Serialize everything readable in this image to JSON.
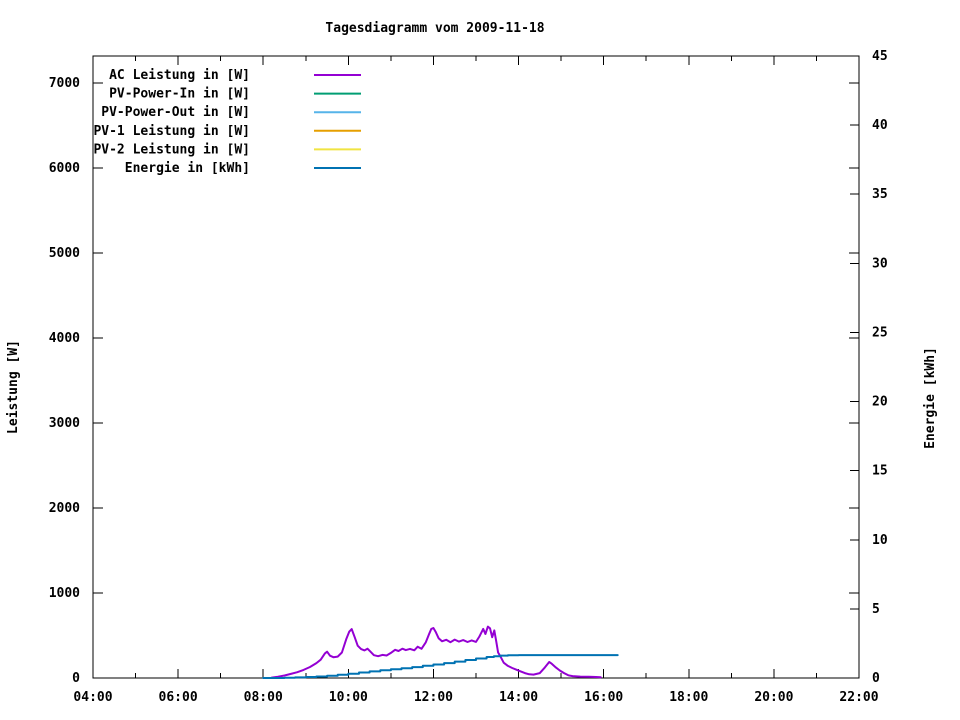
{
  "title": "Tagesdiagramm vom 2009-11-18",
  "chart_data": {
    "type": "line",
    "title": "Tagesdiagramm vom 2009-11-18",
    "x": {
      "range_hours": [
        4,
        22
      ],
      "major_tick_every_h": 2,
      "minor_tick_every_h": 1,
      "tick_labels": [
        "04:00",
        "06:00",
        "08:00",
        "10:00",
        "12:00",
        "14:00",
        "16:00",
        "18:00",
        "20:00",
        "22:00"
      ]
    },
    "y_left": {
      "label": "Leistung [W]",
      "range": [
        0,
        7318
      ],
      "tick_step": 1000,
      "tick_labels": [
        "0",
        "1000",
        "2000",
        "3000",
        "4000",
        "5000",
        "6000",
        "7000"
      ]
    },
    "y_right": {
      "label": "Energie [kWh]",
      "range": [
        0,
        45
      ],
      "tick_step": 5,
      "tick_labels": [
        "0",
        "5",
        "10",
        "15",
        "20",
        "25",
        "30",
        "35",
        "40",
        "45"
      ]
    },
    "legend": {
      "position": "top-left-inside",
      "entries": [
        {
          "label": "AC Leistung in [W]",
          "color": "#9400d3"
        },
        {
          "label": "PV-Power-In in [W]",
          "color": "#009e73"
        },
        {
          "label": "PV-Power-Out in [W]",
          "color": "#56b4e9"
        },
        {
          "label": "PV-1 Leistung in [W]",
          "color": "#e69f00"
        },
        {
          "label": "PV-2 Leistung in [W]",
          "color": "#f0e442"
        },
        {
          "label": "Energie in [kWh]",
          "color": "#0072b2"
        }
      ]
    },
    "series": [
      {
        "name": "AC Leistung in [W]",
        "color": "#9400d3",
        "axis": "left",
        "interp": "linear",
        "points": [
          [
            8.2,
            5
          ],
          [
            8.35,
            15
          ],
          [
            8.5,
            30
          ],
          [
            8.65,
            48
          ],
          [
            8.8,
            68
          ],
          [
            8.95,
            95
          ],
          [
            9.1,
            130
          ],
          [
            9.25,
            175
          ],
          [
            9.35,
            215
          ],
          [
            9.45,
            290
          ],
          [
            9.5,
            310
          ],
          [
            9.57,
            262
          ],
          [
            9.65,
            245
          ],
          [
            9.75,
            252
          ],
          [
            9.85,
            300
          ],
          [
            9.95,
            455
          ],
          [
            10.02,
            545
          ],
          [
            10.08,
            575
          ],
          [
            10.15,
            480
          ],
          [
            10.22,
            380
          ],
          [
            10.3,
            340
          ],
          [
            10.38,
            325
          ],
          [
            10.45,
            345
          ],
          [
            10.52,
            310
          ],
          [
            10.6,
            268
          ],
          [
            10.7,
            256
          ],
          [
            10.8,
            272
          ],
          [
            10.9,
            265
          ],
          [
            11.0,
            295
          ],
          [
            11.1,
            332
          ],
          [
            11.18,
            318
          ],
          [
            11.27,
            345
          ],
          [
            11.35,
            328
          ],
          [
            11.45,
            342
          ],
          [
            11.55,
            326
          ],
          [
            11.63,
            368
          ],
          [
            11.72,
            344
          ],
          [
            11.82,
            420
          ],
          [
            11.9,
            520
          ],
          [
            11.95,
            578
          ],
          [
            12.0,
            588
          ],
          [
            12.05,
            545
          ],
          [
            12.12,
            468
          ],
          [
            12.2,
            432
          ],
          [
            12.3,
            450
          ],
          [
            12.4,
            421
          ],
          [
            12.5,
            452
          ],
          [
            12.6,
            428
          ],
          [
            12.7,
            446
          ],
          [
            12.8,
            424
          ],
          [
            12.9,
            442
          ],
          [
            13.0,
            425
          ],
          [
            13.08,
            488
          ],
          [
            13.17,
            578
          ],
          [
            13.22,
            518
          ],
          [
            13.28,
            605
          ],
          [
            13.33,
            585
          ],
          [
            13.38,
            480
          ],
          [
            13.43,
            560
          ],
          [
            13.48,
            420
          ],
          [
            13.52,
            300
          ],
          [
            13.58,
            248
          ],
          [
            13.65,
            180
          ],
          [
            13.75,
            142
          ],
          [
            13.85,
            118
          ],
          [
            13.95,
            98
          ],
          [
            14.05,
            78
          ],
          [
            14.15,
            58
          ],
          [
            14.25,
            44
          ],
          [
            14.35,
            40
          ],
          [
            14.5,
            58
          ],
          [
            14.62,
            125
          ],
          [
            14.72,
            188
          ],
          [
            14.78,
            168
          ],
          [
            14.88,
            122
          ],
          [
            14.97,
            88
          ],
          [
            15.07,
            58
          ],
          [
            15.17,
            32
          ],
          [
            15.27,
            22
          ],
          [
            15.45,
            16
          ],
          [
            15.65,
            14
          ],
          [
            15.82,
            12
          ],
          [
            15.93,
            10
          ]
        ]
      },
      {
        "name": "Energie in [kWh]",
        "color": "#0072b2",
        "axis": "right",
        "interp": "step",
        "points": [
          [
            8.0,
            0.0
          ],
          [
            8.5,
            0.02
          ],
          [
            8.75,
            0.04
          ],
          [
            9.0,
            0.07
          ],
          [
            9.25,
            0.11
          ],
          [
            9.5,
            0.16
          ],
          [
            9.75,
            0.23
          ],
          [
            10.0,
            0.31
          ],
          [
            10.25,
            0.4
          ],
          [
            10.5,
            0.48
          ],
          [
            10.75,
            0.56
          ],
          [
            11.0,
            0.63
          ],
          [
            11.25,
            0.71
          ],
          [
            11.5,
            0.79
          ],
          [
            11.75,
            0.88
          ],
          [
            12.0,
            0.98
          ],
          [
            12.25,
            1.08
          ],
          [
            12.5,
            1.19
          ],
          [
            12.75,
            1.3
          ],
          [
            13.0,
            1.41
          ],
          [
            13.25,
            1.52
          ],
          [
            13.42,
            1.58
          ],
          [
            13.58,
            1.62
          ],
          [
            13.75,
            1.64
          ],
          [
            14.0,
            1.66
          ],
          [
            16.33,
            1.66
          ]
        ]
      }
    ]
  }
}
